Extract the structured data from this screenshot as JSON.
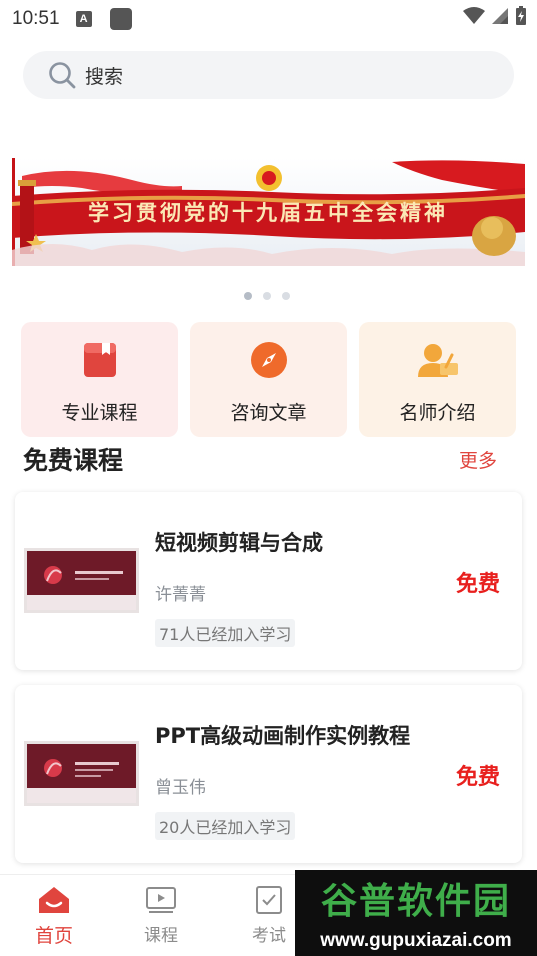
{
  "status_bar": {
    "time": "10:51",
    "notif_letter": "A"
  },
  "search": {
    "placeholder": "搜索"
  },
  "banner": {
    "text": "学习贯彻党的十九届五中全会精神",
    "dots": 3,
    "active_dot": 0
  },
  "quick_menu": [
    {
      "label": "专业课程",
      "icon": "book-icon",
      "color": "#e0453e"
    },
    {
      "label": "咨询文章",
      "icon": "compass-icon",
      "color": "#ef6a2b"
    },
    {
      "label": "名师介绍",
      "icon": "teacher-icon",
      "color": "#f2a73b"
    }
  ],
  "free_courses": {
    "title": "免费课程",
    "more": "更多",
    "items": [
      {
        "title": "短视频剪辑与合成",
        "teacher": "许菁菁",
        "enrolled": "71人已经加入学习",
        "price": "免费"
      },
      {
        "title": "PPT高级动画制作实例教程",
        "teacher": "曾玉伟",
        "enrolled": "20人已经加入学习",
        "price": "免费"
      }
    ]
  },
  "bottom_nav": [
    {
      "label": "首页",
      "icon": "home-icon",
      "active": true
    },
    {
      "label": "课程",
      "icon": "video-icon",
      "active": false
    },
    {
      "label": "考试",
      "icon": "exam-icon",
      "active": false
    }
  ],
  "watermark": {
    "name": "谷普软件园",
    "url": "www.gupuxiazai.com"
  },
  "colors": {
    "accent": "#e0453e",
    "price": "#e8201e"
  }
}
